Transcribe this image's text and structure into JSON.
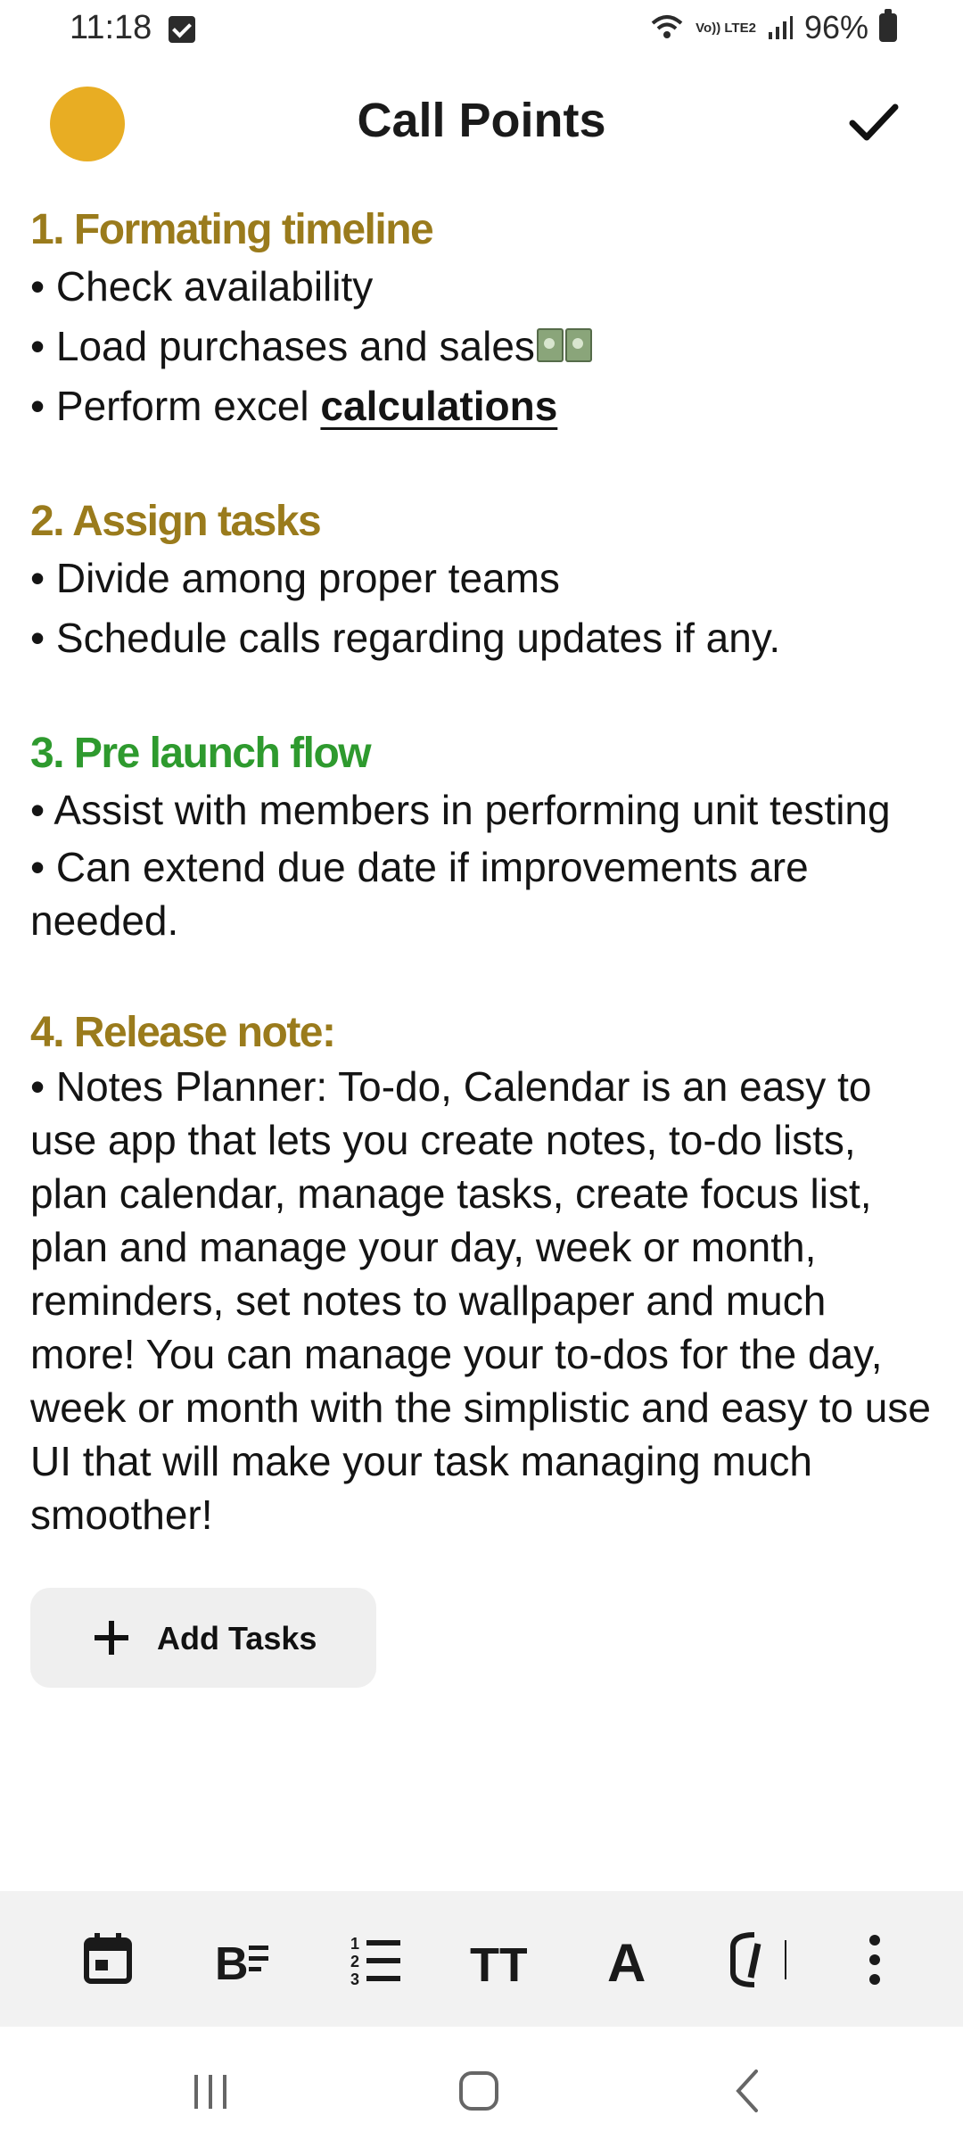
{
  "status_bar": {
    "time": "11:18",
    "network_label": "Vo)) LTE2",
    "battery": "96%"
  },
  "header": {
    "title": "Call Points",
    "avatar_color": "#e8ad23"
  },
  "colors": {
    "heading_gold": "#9a7b1c",
    "heading_green": "#2e9a2e",
    "text": "#141414"
  },
  "sections": [
    {
      "heading": "1. Formating timeline",
      "bullets": [
        "• Check availability",
        "• Load purchases and sales",
        "• Perform excel "
      ],
      "underlined": "calculations"
    },
    {
      "heading": "2. Assign tasks",
      "bullets": [
        "• Divide among proper teams",
        "• Schedule calls regarding updates if any."
      ]
    },
    {
      "heading": "3. Pre launch flow",
      "bullets": [
        "• Assist with members in performing unit testing",
        "• Can extend due date if improvements are needed."
      ]
    },
    {
      "heading": "4. Release note:",
      "paragraph": "• Notes Planner: To-do, Calendar is an easy to use app that lets you create notes, to-do lists, plan calendar, manage tasks, create focus list, plan and manage your day, week or month, reminders, set notes to wallpaper and much more! You can manage your to-dos for the day, week or month with the simplistic and easy to use UI that will make your task managing much smoother!"
    }
  ],
  "add_tasks": {
    "label": "Add Tasks"
  },
  "toolbar": {
    "text_size_label": "TT",
    "text_color_label": "A",
    "tools": [
      "calendar-icon",
      "bold-list-icon",
      "numbered-list-icon",
      "text-size-icon",
      "text-color-icon",
      "highlight-icon",
      "more-icon"
    ]
  },
  "nav": {
    "buttons": [
      "recent-apps",
      "home",
      "back"
    ]
  }
}
